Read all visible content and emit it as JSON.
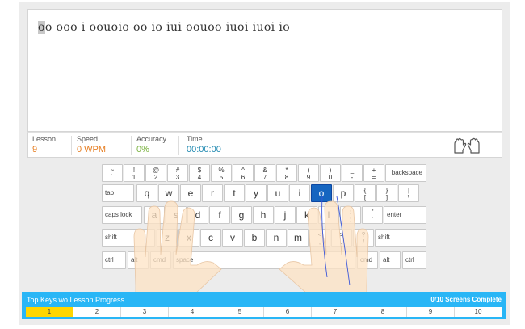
{
  "typing": {
    "cursor_char": "o",
    "rest_text": "o ooo i oouoio oo io iui oouoo iuoi iuoi io"
  },
  "stats": {
    "lesson": {
      "label": "Lesson",
      "value": "9",
      "color": "#e67e22"
    },
    "speed": {
      "label": "Speed",
      "value": "0 WPM",
      "color": "#e67e22"
    },
    "accuracy": {
      "label": "Accuracy",
      "value": "0%",
      "color": "#7cb342"
    },
    "time": {
      "label": "Time",
      "value": "00:00:00",
      "color": "#1e88b0"
    }
  },
  "keyboard": {
    "active_key": "o",
    "row1": [
      {
        "top": "~",
        "bottom": "`"
      },
      {
        "top": "!",
        "bottom": "1"
      },
      {
        "top": "@",
        "bottom": "2"
      },
      {
        "top": "#",
        "bottom": "3"
      },
      {
        "top": "$",
        "bottom": "4"
      },
      {
        "top": "%",
        "bottom": "5"
      },
      {
        "top": "^",
        "bottom": "6"
      },
      {
        "top": "&",
        "bottom": "7"
      },
      {
        "top": "*",
        "bottom": "8"
      },
      {
        "top": "(",
        "bottom": "9"
      },
      {
        "top": ")",
        "bottom": "0"
      },
      {
        "top": "_",
        "bottom": "-"
      },
      {
        "top": "+",
        "bottom": "="
      }
    ],
    "backspace": "backspace",
    "tab": "tab",
    "row2": [
      "q",
      "w",
      "e",
      "r",
      "t",
      "y",
      "u",
      "i",
      "o",
      "p"
    ],
    "row2_symbols": [
      {
        "top": "{",
        "bottom": "["
      },
      {
        "top": "}",
        "bottom": "]"
      },
      {
        "top": "|",
        "bottom": "\\"
      }
    ],
    "caps_lock": "caps lock",
    "row3": [
      "a",
      "s",
      "d",
      "f",
      "g",
      "h",
      "j",
      "k",
      "l"
    ],
    "row3_symbols": [
      {
        "top": ":",
        "bottom": ";"
      },
      {
        "top": "\"",
        "bottom": "'"
      }
    ],
    "enter": "enter",
    "shift_left": "shift",
    "row4": [
      "z",
      "x",
      "c",
      "v",
      "b",
      "n",
      "m"
    ],
    "row4_symbols": [
      {
        "top": "<",
        "bottom": ","
      },
      {
        "top": ">",
        "bottom": "."
      },
      {
        "top": "?",
        "bottom": "/"
      }
    ],
    "shift_right": "shift",
    "ctrl_left": "ctrl",
    "alt_left": "alt",
    "cmd_left": "cmd",
    "space": "space",
    "cmd_right": "cmd",
    "alt_right": "alt",
    "ctrl_right": "ctrl"
  },
  "progress": {
    "title": "Top Keys wo Lesson Progress",
    "count": "0/10 Screens Complete",
    "segments": [
      "1",
      "2",
      "3",
      "4",
      "5",
      "6",
      "7",
      "8",
      "9",
      "10"
    ],
    "current": "1"
  },
  "colors": {
    "accent_blue": "#29b6f6",
    "active_key": "#1565c0",
    "current_segment": "#ffd600"
  }
}
